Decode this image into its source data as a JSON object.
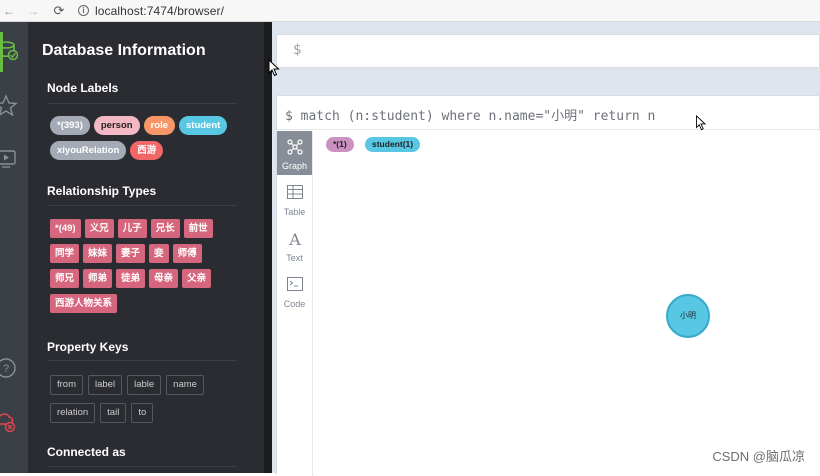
{
  "browser": {
    "back": "←",
    "forward": "→",
    "reload": "⟳",
    "info_icon": "i",
    "url": "localhost:7474/browser/"
  },
  "rail": {
    "icons": [
      "database-icon",
      "star-icon",
      "monitor-play-icon",
      "help-icon",
      "disconnect-cloud-icon"
    ]
  },
  "sidebar": {
    "title": "Database Information",
    "node_labels_title": "Node Labels",
    "node_labels": [
      {
        "label": "*(393)",
        "color": "#a5abb6"
      },
      {
        "label": "person",
        "color": "#f3b8c4"
      },
      {
        "label": "role",
        "color": "#f79767"
      },
      {
        "label": "student",
        "color": "#57c7e3"
      },
      {
        "label": "xiyouRelation",
        "color": "#a5abb6"
      },
      {
        "label": "西游",
        "color": "#f16667"
      }
    ],
    "rel_types_title": "Relationship Types",
    "rel_types": [
      "*(49)",
      "义兄",
      "儿子",
      "兄长",
      "前世",
      "同学",
      "妹妹",
      "妻子",
      "妾",
      "师傅",
      "师兄",
      "师弟",
      "徒弟",
      "母亲",
      "父亲",
      "西游人物关系"
    ],
    "prop_keys_title": "Property Keys",
    "prop_keys": [
      "from",
      "label",
      "lable",
      "name",
      "relation",
      "tail",
      "to"
    ],
    "connected_title": "Connected as"
  },
  "editor": {
    "prompt": "$"
  },
  "frame": {
    "query": "$ match (n:student) where n.name=\"小明\" return n",
    "tabs": [
      {
        "label": "Graph",
        "icon": "graph-icon"
      },
      {
        "label": "Table",
        "icon": "table-icon"
      },
      {
        "label": "Text",
        "icon": "text-icon"
      },
      {
        "label": "Code",
        "icon": "code-icon"
      }
    ],
    "legend": [
      {
        "label": "*(1)",
        "color": "#c990c0"
      },
      {
        "label": "student(1)",
        "color": "#57c7e3"
      }
    ],
    "node_label": "小明"
  },
  "watermark": "CSDN @脑瓜凉"
}
